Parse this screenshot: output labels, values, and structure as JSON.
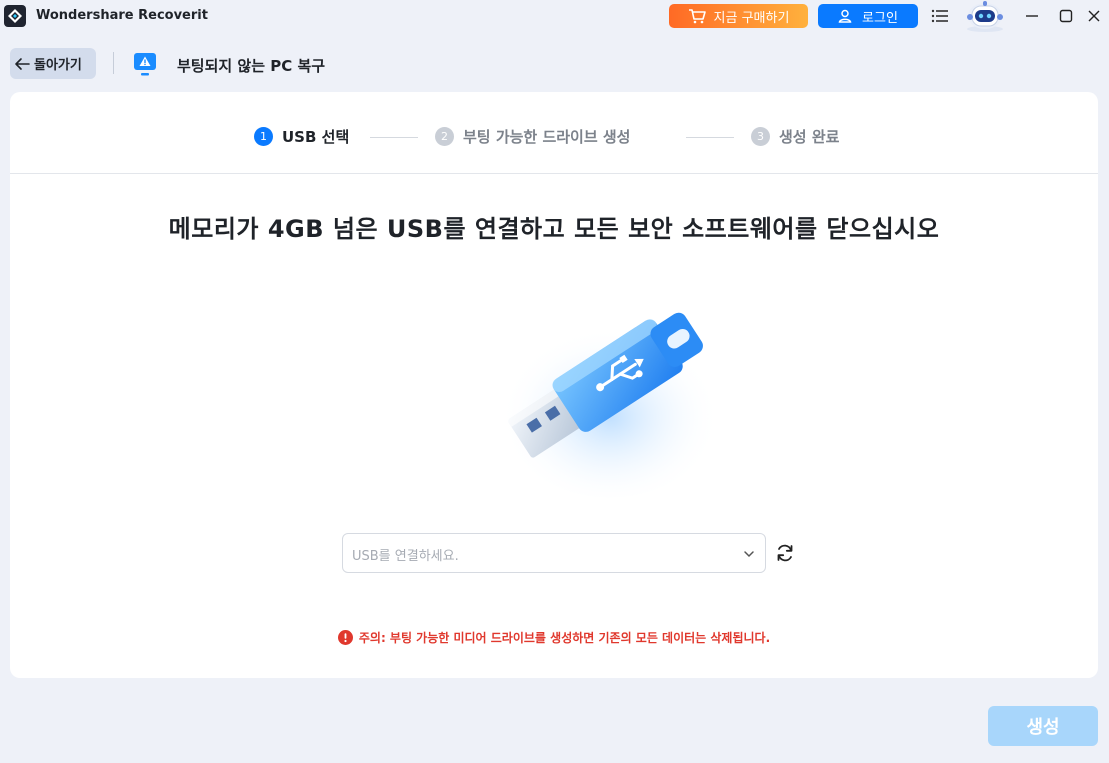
{
  "window": {
    "app_title": "Wondershare Recoverit",
    "buy_label": "지금 구매하기",
    "login_label": "로그인"
  },
  "header": {
    "back_label": "돌아가기",
    "page_title": "부팅되지 않는 PC 복구"
  },
  "steps": [
    {
      "number": "1",
      "label": "USB 선택",
      "state": "active"
    },
    {
      "number": "2",
      "label": "부팅 가능한 드라이브 생성",
      "state": "inactive"
    },
    {
      "number": "3",
      "label": "생성 완료",
      "state": "inactive"
    }
  ],
  "main": {
    "headline": "메모리가 4GB 넘은 USB를 연결하고 모든 보안 소프트웨어를 닫으십시오",
    "usb_select_placeholder": "USB를 연결하세요.",
    "warning": "주의: 부팅 가능한 미디어 드라이브를 생성하면 기존의 모든 데이터는 삭제됩니다."
  },
  "footer": {
    "create_label": "생성"
  },
  "colors": {
    "accent": "#0a7aff",
    "buy_gradient_start": "#ff6a25",
    "buy_gradient_end": "#ffb13d",
    "warning": "#e0382d",
    "disabled_button": "#a8d6fb",
    "background": "#eef1f8"
  },
  "icons": [
    "app-logo-icon",
    "cart-icon",
    "user-icon",
    "menu-icon",
    "robot-avatar-icon",
    "minimize-icon",
    "maximize-icon",
    "close-icon",
    "arrow-left-icon",
    "warning-monitor-icon",
    "usb-drive-icon",
    "chevron-down-icon",
    "refresh-icon",
    "error-icon"
  ]
}
